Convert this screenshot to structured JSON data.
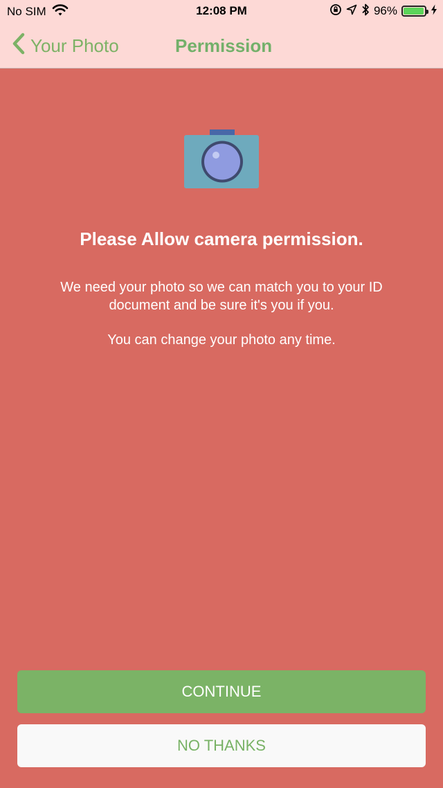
{
  "status_bar": {
    "carrier": "No SIM",
    "time": "12:08 PM",
    "battery_percent": "96%",
    "battery_level": 0.96,
    "icons": [
      "wifi-icon",
      "lock-rotation-icon",
      "location-arrow-icon",
      "bluetooth-icon",
      "battery-icon",
      "charging-bolt-icon"
    ]
  },
  "nav": {
    "back_label": "Your Photo",
    "title": "Permission"
  },
  "content": {
    "icon": "camera-icon",
    "heading": "Please Allow camera permission.",
    "paragraph1": "We need your photo so we can match you to your ID document and be sure it's you if you.",
    "paragraph2": "You can change your photo any time."
  },
  "buttons": {
    "continue_label": "CONTINUE",
    "no_thanks_label": "NO THANKS"
  },
  "colors": {
    "background": "#D86A61",
    "header": "#FDD9D6",
    "accent_green": "#7BB366",
    "camera_body": "#6EAABD",
    "camera_lens": "#8F9BE0"
  }
}
